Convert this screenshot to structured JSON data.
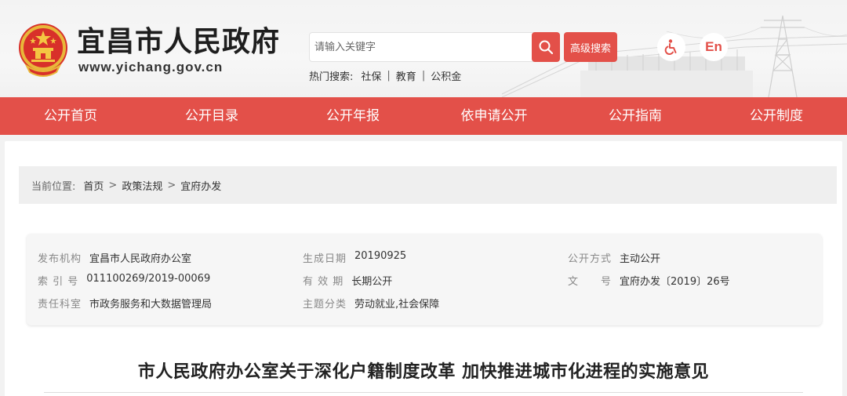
{
  "header": {
    "site_title": "宜昌市人民政府",
    "site_url": "www.yichang.gov.cn",
    "search": {
      "placeholder": "请输入关键字"
    },
    "advanced_search_label": "高级搜索",
    "hot_search": {
      "label": "热门搜索:",
      "items": [
        "社保",
        "教育",
        "公积金"
      ]
    },
    "english_label": "En"
  },
  "nav": {
    "items": [
      "公开首页",
      "公开目录",
      "公开年报",
      "依申请公开",
      "公开指南",
      "公开制度"
    ]
  },
  "breadcrumb": {
    "label": "当前位置:",
    "items": [
      "首页",
      "政策法规",
      "宜府办发"
    ],
    "separator": ">"
  },
  "meta": {
    "publisher": {
      "label": "发布机构",
      "value": "宜昌市人民政府办公室"
    },
    "created": {
      "label": "生成日期",
      "value": "20190925"
    },
    "disclosure": {
      "label": "公开方式",
      "value": "主动公开"
    },
    "index_no": {
      "label": "索 引 号",
      "value": "011100269/2019-00069"
    },
    "validity": {
      "label": "有 效 期",
      "value": "长期公开"
    },
    "doc_no": {
      "label": "文　　号",
      "value": "宜府办发〔2019〕26号"
    },
    "office": {
      "label": "责任科室",
      "value": "市政务服务和大数据管理局"
    },
    "topic": {
      "label": "主题分类",
      "value": "劳动就业,社会保障"
    }
  },
  "document": {
    "title": "市人民政府办公室关于深化户籍制度改革 加快推进城市化进程的实施意见"
  },
  "colors": {
    "accent": "#e35049",
    "page_bg": "#f2f2f2",
    "panel_bg": "#ffffff"
  },
  "icons": [
    "national-emblem-icon",
    "search-icon",
    "accessibility-icon"
  ]
}
